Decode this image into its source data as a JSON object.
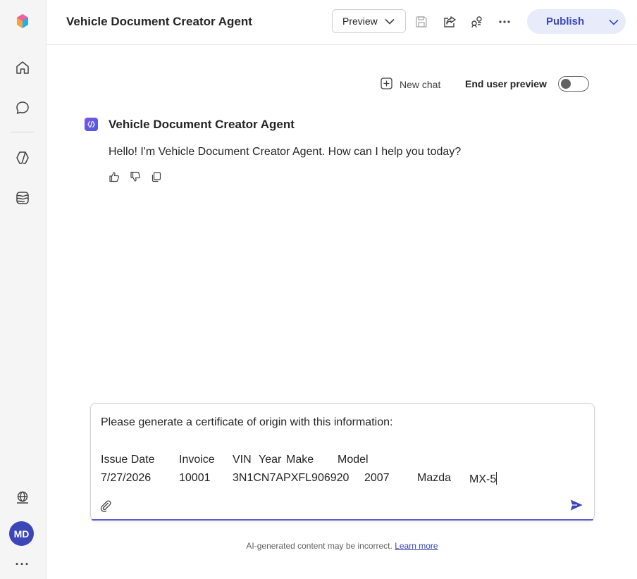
{
  "app": {
    "title": "Vehicle Document Creator Agent"
  },
  "header": {
    "preview_label": "Preview",
    "publish_label": "Publish"
  },
  "rail": {
    "avatar_initials": "MD",
    "more_label": "···"
  },
  "chat": {
    "new_chat_label": "New chat",
    "end_user_preview_label": "End user preview",
    "end_user_preview_on": false,
    "bot_name": "Vehicle Document Creator Agent",
    "bot_greeting": "Hello! I'm Vehicle Document Creator Agent. How can I help you today?"
  },
  "composer": {
    "line1": "Please generate a certificate of origin with this information:",
    "headers": [
      "Issue Date",
      "Invoice",
      "VIN",
      "Year",
      "Make",
      "Model"
    ],
    "values": [
      "7/27/2026",
      "10001",
      "3N1CN7APXFL906920",
      "2007",
      "Mazda",
      "MX-5"
    ]
  },
  "footer": {
    "disclaimer": "AI-generated content may be incorrect.",
    "learn_more": "Learn more"
  },
  "colors": {
    "accent": "#3b46b8",
    "publish_bg": "#e8ebfa",
    "composer_focus": "#5b5fc7"
  }
}
